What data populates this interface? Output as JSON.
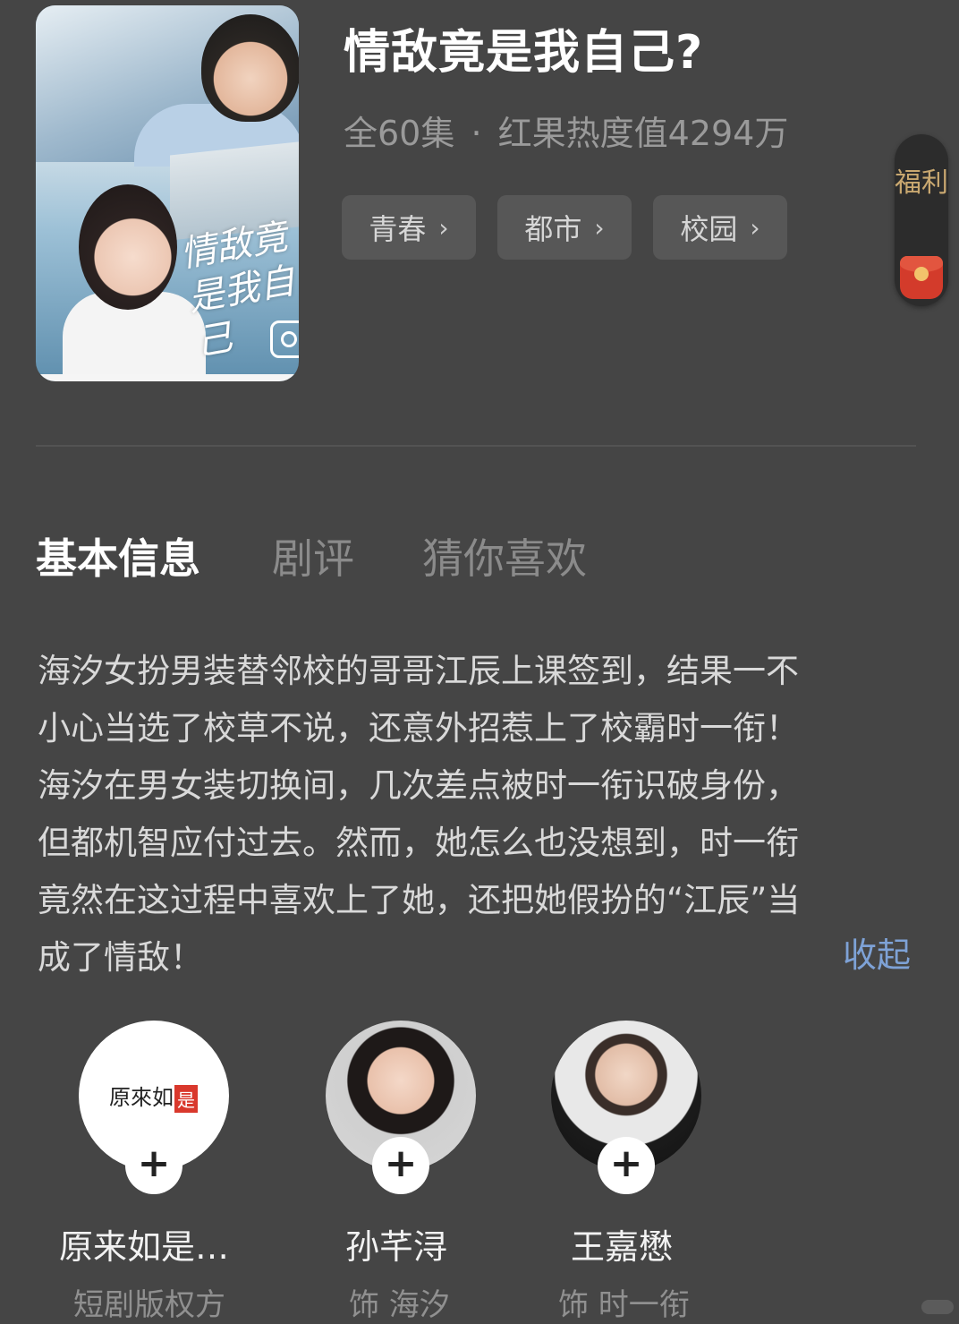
{
  "drama": {
    "title": "情敌竟是我自己?",
    "episodes": "全60集",
    "separator": "·",
    "heat": "红果热度值4294万",
    "poster_calligraphy": "情敌竟是我自己"
  },
  "tags": [
    {
      "label": "青春",
      "chevron": "›"
    },
    {
      "label": "都市",
      "chevron": "›"
    },
    {
      "label": "校园",
      "chevron": "›"
    }
  ],
  "welfare": {
    "label": "福利",
    "icon": "red-packet-icon"
  },
  "tabs": [
    {
      "label": "基本信息",
      "active": true
    },
    {
      "label": "剧评",
      "active": false
    },
    {
      "label": "猜你喜欢",
      "active": false
    }
  ],
  "description": {
    "lines": [
      "海汐女扮男装替邻校的哥哥江辰上课签到，结果一不",
      "小心当选了校草不说，还意外招惹上了校霸时一衔！",
      "海汐在男女装切换间，几次差点被时一衔识破身份，",
      "但都机智应付过去。然而，她怎么也没想到，时一衔",
      "竟然在这过程中喜欢上了她，还把她假扮的“江辰”当",
      "成了情敌！"
    ],
    "collapse_label": "收起"
  },
  "cast": [
    {
      "name": "原来如是…",
      "role": "短剧版权方",
      "avatar_text": "原來如",
      "avatar_seal": "是",
      "plus": "+"
    },
    {
      "name": "孙芊浔",
      "role": "饰 海汐",
      "plus": "+"
    },
    {
      "name": "王嘉懋",
      "role": "饰 时一衔",
      "plus": "+"
    }
  ],
  "colors": {
    "background": "#454545",
    "accent_link": "#7ea2d6",
    "welfare_text": "#c9a870",
    "red_packet": "#d33b2b"
  }
}
